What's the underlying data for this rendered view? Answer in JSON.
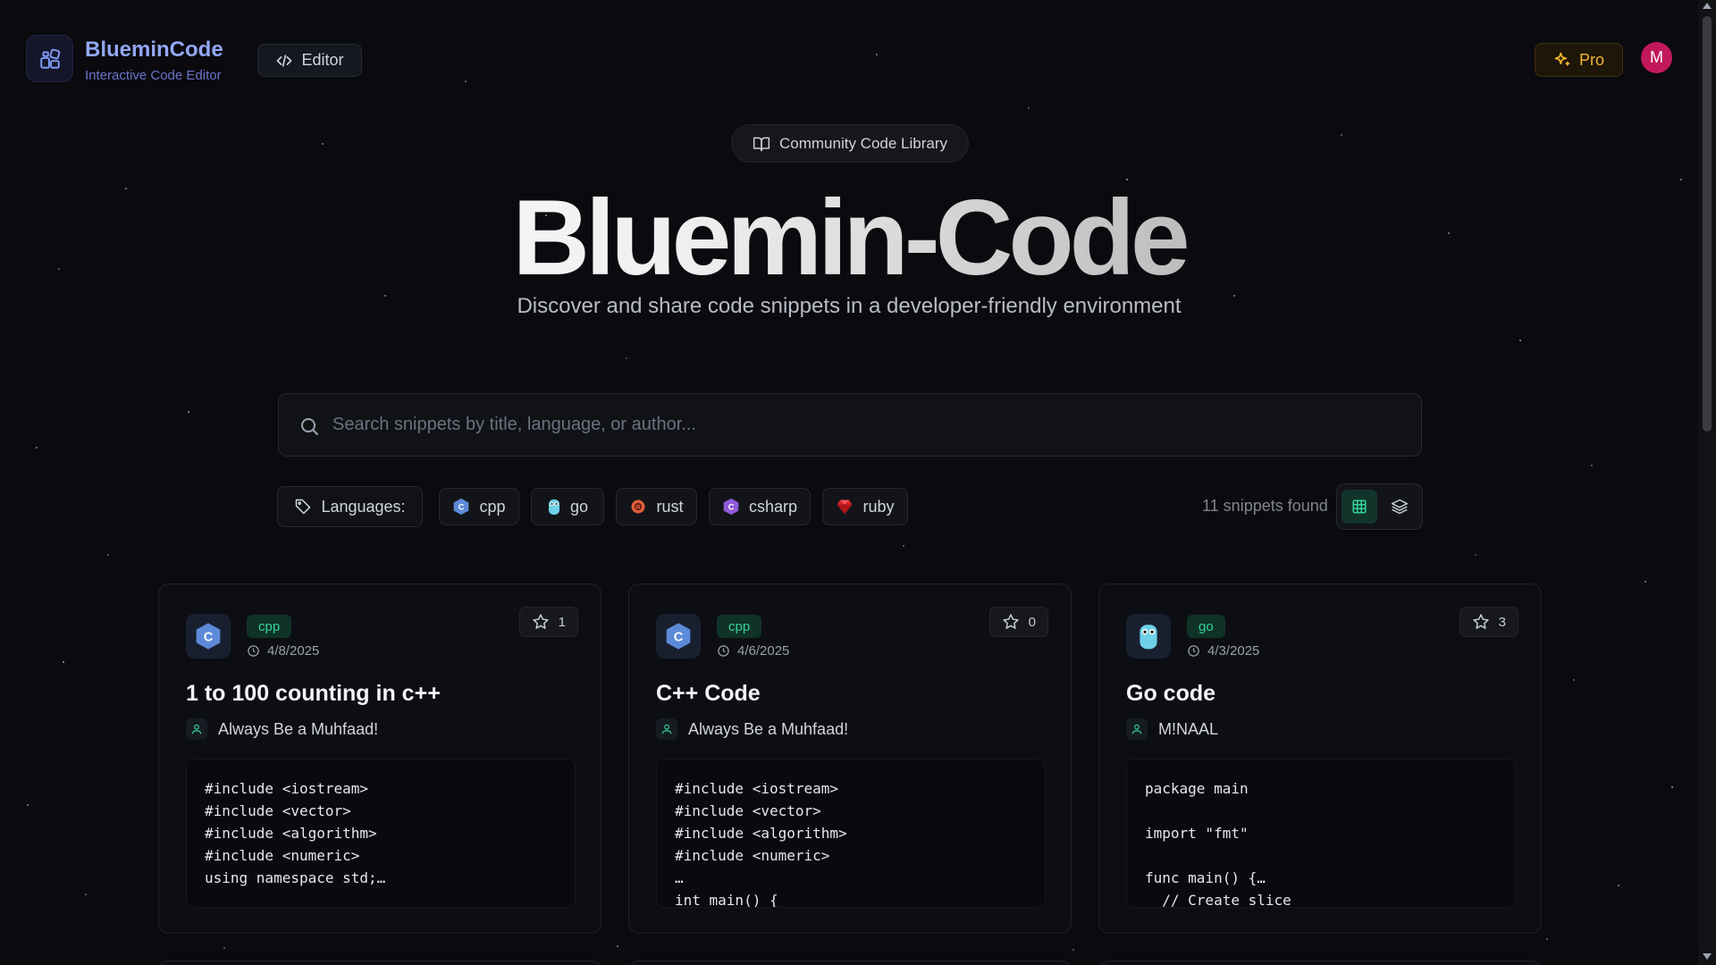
{
  "brand": {
    "name": "BlueminCode",
    "subtitle": "Interactive Code Editor",
    "logo_icon": "layout-grid-icon"
  },
  "nav": {
    "editor_label": "Editor",
    "pro_label": "Pro",
    "avatar_initial": "M",
    "avatar_color": "#c2185b"
  },
  "hero": {
    "badge": "Community Code Library",
    "title": "Bluemin-Code",
    "subtitle": "Discover and share code snippets in a developer-friendly environment"
  },
  "search": {
    "placeholder": "Search snippets by title, language, or author...",
    "value": ""
  },
  "filters": {
    "label": "Languages:",
    "languages": [
      {
        "name": "cpp",
        "icon": "cpp-logo-icon"
      },
      {
        "name": "go",
        "icon": "go-gopher-icon"
      },
      {
        "name": "rust",
        "icon": "rust-logo-icon"
      },
      {
        "name": "csharp",
        "icon": "csharp-logo-icon"
      },
      {
        "name": "ruby",
        "icon": "ruby-gem-icon"
      }
    ],
    "count_text": "11 snippets found",
    "view_mode": "grid"
  },
  "snippets": [
    {
      "language": "cpp",
      "date": "4/8/2025",
      "stars": "1",
      "title": "1 to 100 counting in c++",
      "author": "Always Be a Muhfaad!",
      "code": "#include <iostream>\n#include <vector>\n#include <algorithm>\n#include <numeric>\nusing namespace std;…"
    },
    {
      "language": "cpp",
      "date": "4/6/2025",
      "stars": "0",
      "title": "C++ Code",
      "author": "Always Be a Muhfaad!",
      "code": "#include <iostream>\n#include <vector>\n#include <algorithm>\n#include <numeric>\n…\nint main() {"
    },
    {
      "language": "go",
      "date": "4/3/2025",
      "stars": "3",
      "title": "Go code",
      "author": "M!NAAL",
      "code": "package main\n\nimport \"fmt\"\n\nfunc main() {…\n  // Create slice"
    }
  ],
  "colors": {
    "accent_green": "#34d399",
    "pro_gold": "#f3b533",
    "brand_blue": "#93a7f5"
  }
}
